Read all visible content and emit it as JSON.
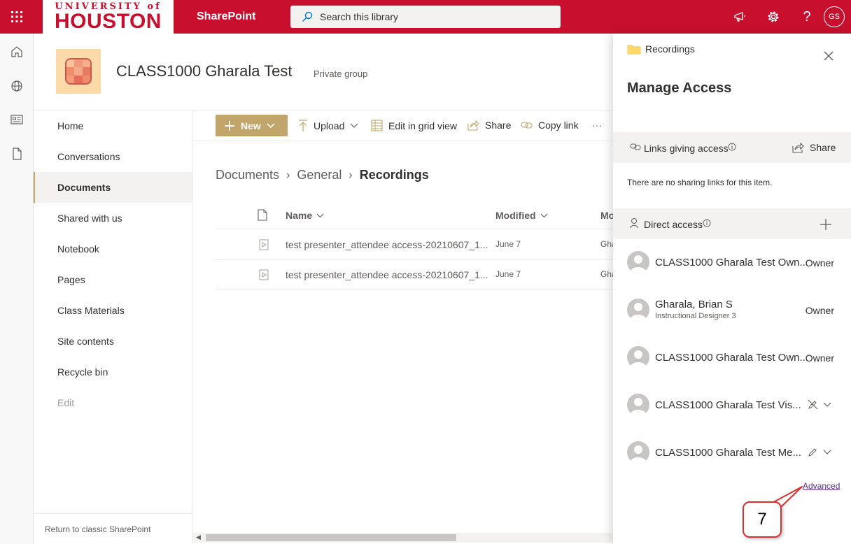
{
  "topbar": {
    "logo_top": "UNIVERSITY of",
    "logo_main": "HOUSTON",
    "app_name": "SharePoint",
    "search_placeholder": "Search this library",
    "avatar_initials": "GS",
    "brand_color": "#c8102e"
  },
  "site": {
    "title": "CLASS1000 Gharala Test",
    "privacy": "Private group"
  },
  "leftnav": {
    "items": [
      {
        "label": "Home"
      },
      {
        "label": "Conversations"
      },
      {
        "label": "Documents"
      },
      {
        "label": "Shared with us"
      },
      {
        "label": "Notebook"
      },
      {
        "label": "Pages"
      },
      {
        "label": "Class Materials"
      },
      {
        "label": "Site contents"
      },
      {
        "label": "Recycle bin"
      },
      {
        "label": "Edit"
      }
    ],
    "active": "Documents",
    "classic_link": "Return to classic SharePoint"
  },
  "commandbar": {
    "new_label": "New",
    "upload_label": "Upload",
    "grid_label": "Edit in grid view",
    "share_label": "Share",
    "copy_label": "Copy link",
    "more_label": "···"
  },
  "breadcrumb": [
    "Documents",
    "General",
    "Recordings"
  ],
  "list": {
    "columns": {
      "name": "Name",
      "modified": "Modified",
      "modified_by": "Mo"
    },
    "rows": [
      {
        "name": "test presenter_attendee access-20210607_1...",
        "modified": "June 7",
        "modified_by": "Gha"
      },
      {
        "name": "test presenter_attendee access-20210607_1...",
        "modified": "June 7",
        "modified_by": "Gha"
      }
    ]
  },
  "panel": {
    "folder": "Recordings",
    "title": "Manage Access",
    "links_section": "Links giving access",
    "share_label": "Share",
    "no_links": "There are no sharing links for this item.",
    "direct_section": "Direct access",
    "people": [
      {
        "name": "CLASS1000 Gharala Test Own...",
        "role": "Owner",
        "sub": ""
      },
      {
        "name": "Gharala, Brian S",
        "role": "Owner",
        "sub": "Instructional Designer 3"
      },
      {
        "name": "CLASS1000 Gharala Test Own...",
        "role": "Owner",
        "sub": ""
      },
      {
        "name": "CLASS1000 Gharala Test Vis...",
        "role": "",
        "sub": "",
        "perm_icon": "no-edit-icon"
      },
      {
        "name": "CLASS1000 Gharala Test Me...",
        "role": "",
        "sub": "",
        "perm_icon": "pencil-icon"
      }
    ],
    "advanced_link": "Advanced"
  },
  "callout": {
    "number": "7",
    "color": "#d9302c"
  }
}
